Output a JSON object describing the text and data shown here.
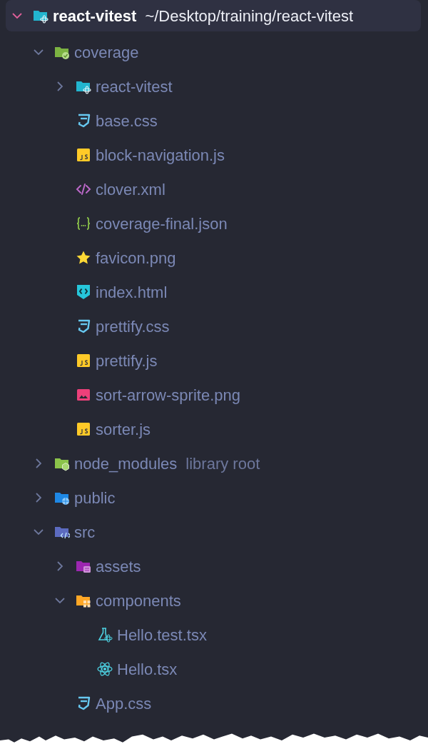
{
  "tree": [
    {
      "name": "react-vitest",
      "suffix": "~/Desktop/training/react-vitest",
      "kind": "folder-react",
      "expanded": true,
      "selected": true,
      "children": [
        {
          "name": "coverage",
          "kind": "folder-coverage",
          "expanded": true,
          "selected": false,
          "children": [
            {
              "name": "react-vitest",
              "kind": "folder-react",
              "expanded": false,
              "selected": false
            },
            {
              "name": "base.css",
              "kind": "css",
              "selected": false
            },
            {
              "name": "block-navigation.js",
              "kind": "js",
              "selected": false
            },
            {
              "name": "clover.xml",
              "kind": "xml",
              "selected": false
            },
            {
              "name": "coverage-final.json",
              "kind": "json",
              "selected": false
            },
            {
              "name": "favicon.png",
              "kind": "star",
              "selected": false
            },
            {
              "name": "index.html",
              "kind": "html",
              "selected": false
            },
            {
              "name": "prettify.css",
              "kind": "css",
              "selected": false
            },
            {
              "name": "prettify.js",
              "kind": "js",
              "selected": false
            },
            {
              "name": "sort-arrow-sprite.png",
              "kind": "image",
              "selected": false
            },
            {
              "name": "sorter.js",
              "kind": "js",
              "selected": false
            }
          ]
        },
        {
          "name": "node_modules",
          "suffix": "library root",
          "kind": "folder-node",
          "expanded": false,
          "selected": false
        },
        {
          "name": "public",
          "kind": "folder-public",
          "expanded": false,
          "selected": false
        },
        {
          "name": "src",
          "kind": "folder-src",
          "expanded": true,
          "selected": false,
          "children": [
            {
              "name": "assets",
              "kind": "folder-assets",
              "expanded": false,
              "selected": false
            },
            {
              "name": "components",
              "kind": "folder-components",
              "expanded": true,
              "selected": false,
              "children": [
                {
                  "name": "Hello.test.tsx",
                  "kind": "test",
                  "selected": false
                },
                {
                  "name": "Hello.tsx",
                  "kind": "react",
                  "selected": false
                }
              ]
            },
            {
              "name": "App.css",
              "kind": "css",
              "selected": false
            }
          ]
        }
      ]
    }
  ]
}
